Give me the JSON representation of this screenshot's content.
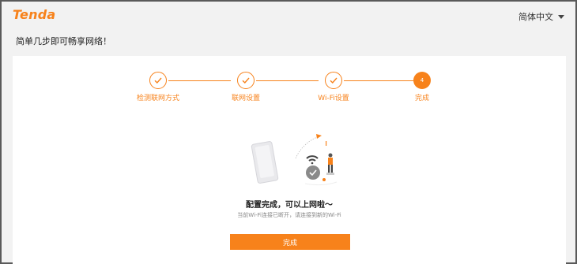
{
  "header": {
    "logo_text": "Tenda",
    "language": "简体中文"
  },
  "subtitle": "简单几步即可畅享网络！",
  "steps": [
    {
      "label": "检测联网方式",
      "state": "done"
    },
    {
      "label": "联网设置",
      "state": "done"
    },
    {
      "label": "Wi-Fi设置",
      "state": "done"
    },
    {
      "label": "完成",
      "state": "active",
      "number": "4"
    }
  ],
  "result": {
    "title": "配置完成，可以上网啦～",
    "description": "当前Wi-Fi连接已断开，请连接到新的Wi-Fi"
  },
  "finish_button": "完成",
  "colors": {
    "accent": "#f7821b",
    "background": "#f2f2f2",
    "panel": "#ffffff"
  }
}
